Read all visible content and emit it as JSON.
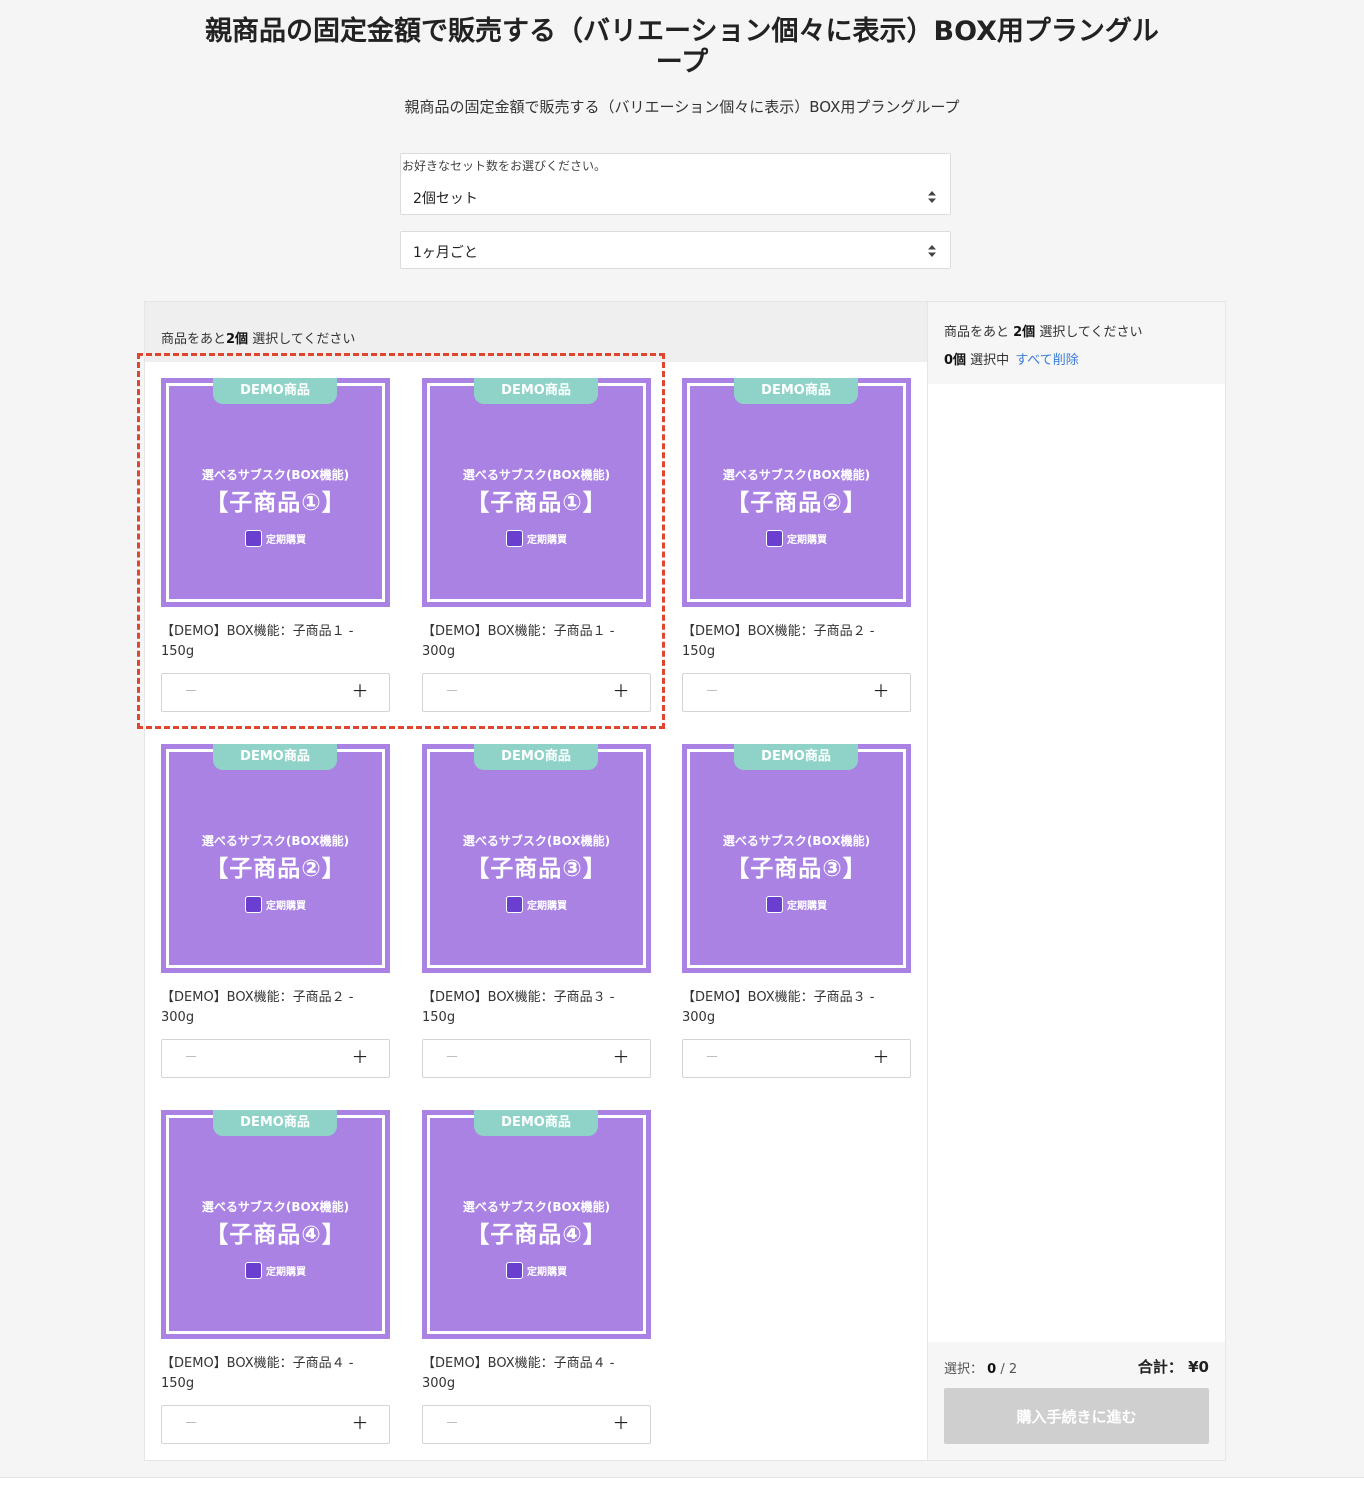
{
  "page": {
    "title": "親商品の固定金額で販売する（バリエーション個々に表示）BOX用プラングループ",
    "subtitle": "親商品の固定金額で販売する（バリエーション個々に表示）BOX用プラングループ"
  },
  "set_select": {
    "label": "お好きなセット数をお選びください。",
    "value": "2個セット"
  },
  "interval_select": {
    "value": "1ヶ月ごと"
  },
  "main": {
    "header_prefix": "商品をあと",
    "header_count": "2個",
    "header_suffix": " 選択してください"
  },
  "cards": [
    {
      "tab": "DEMO商品",
      "line1": "選べるサブスク(BOX機能)",
      "line2": "【子商品①】",
      "logo": "定期購買",
      "name": "【DEMO】BOX機能：子商品１ - 150g",
      "minus": "－",
      "plus": "＋"
    },
    {
      "tab": "DEMO商品",
      "line1": "選べるサブスク(BOX機能)",
      "line2": "【子商品①】",
      "logo": "定期購買",
      "name": "【DEMO】BOX機能：子商品１ - 300g",
      "minus": "－",
      "plus": "＋"
    },
    {
      "tab": "DEMO商品",
      "line1": "選べるサブスク(BOX機能)",
      "line2": "【子商品②】",
      "logo": "定期購買",
      "name": "【DEMO】BOX機能：子商品２ - 150g",
      "minus": "－",
      "plus": "＋"
    },
    {
      "tab": "DEMO商品",
      "line1": "選べるサブスク(BOX機能)",
      "line2": "【子商品②】",
      "logo": "定期購買",
      "name": "【DEMO】BOX機能：子商品２ - 300g",
      "minus": "－",
      "plus": "＋"
    },
    {
      "tab": "DEMO商品",
      "line1": "選べるサブスク(BOX機能)",
      "line2": "【子商品③】",
      "logo": "定期購買",
      "name": "【DEMO】BOX機能：子商品３ - 150g",
      "minus": "－",
      "plus": "＋"
    },
    {
      "tab": "DEMO商品",
      "line1": "選べるサブスク(BOX機能)",
      "line2": "【子商品③】",
      "logo": "定期購買",
      "name": "【DEMO】BOX機能：子商品３ - 300g",
      "minus": "－",
      "plus": "＋"
    },
    {
      "tab": "DEMO商品",
      "line1": "選べるサブスク(BOX機能)",
      "line2": "【子商品④】",
      "logo": "定期購買",
      "name": "【DEMO】BOX機能：子商品４ - 150g",
      "minus": "－",
      "plus": "＋"
    },
    {
      "tab": "DEMO商品",
      "line1": "選べるサブスク(BOX機能)",
      "line2": "【子商品④】",
      "logo": "定期購買",
      "name": "【DEMO】BOX機能：子商品４ - 300g",
      "minus": "－",
      "plus": "＋"
    }
  ],
  "side": {
    "need_prefix": "商品をあと ",
    "need_count": "2個",
    "need_suffix": " 選択してください",
    "selected_count": "0個",
    "selected_suffix": " 選択中",
    "clear_all": "すべて削除",
    "sel_label": "選択：",
    "sel_current": "0",
    "sel_total": " / 2",
    "total_label": "合計：",
    "total_value": "¥0",
    "checkout_label": "購入手続きに進む"
  },
  "colors": {
    "card_bg": "#a982e4",
    "demo_tab": "#8fd3c8",
    "highlight": "#e0462f",
    "link": "#3a7bd5",
    "disabled_button": "#cfcfcf"
  },
  "icons": {
    "select_arrow": "updown-arrows-icon",
    "minus": "minus-icon",
    "plus": "plus-icon",
    "logo": "subscription-logo-icon"
  }
}
